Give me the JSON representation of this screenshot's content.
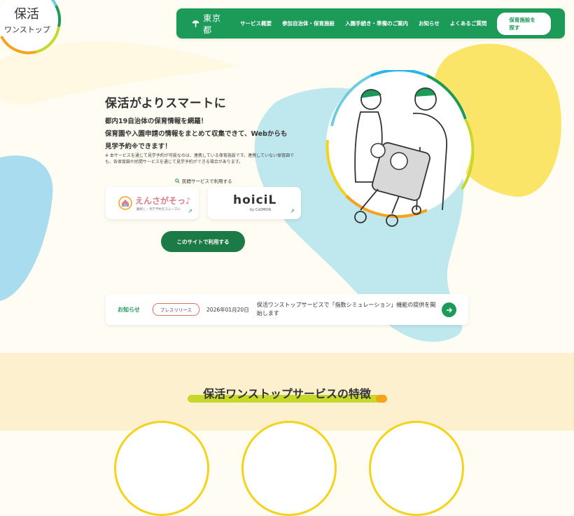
{
  "site": {
    "logo_text_line1": "保活",
    "logo_text_line2": "ワンストップ"
  },
  "header": {
    "org_name": "東京都",
    "nav": [
      "サービス概要",
      "参加自治体・保育施設",
      "入園手続き・準備のご案内",
      "お知らせ",
      "よくあるご質問"
    ],
    "search_button": "保育施設を探す"
  },
  "hero": {
    "title": "保活がよりスマートに",
    "lines": [
      "都内19自治体の保育情報を網羅！",
      "保育園や入園申請の情報をまとめて収集できて、Webからも",
      "見学予約※できます！"
    ],
    "note": "※ 本サービスを通じて見学予約が可能なのは、連携している保育施設です。連携していない保育園でも、各保育園や民間サービスを通じて見学予約ができる場合があります。",
    "private_services_label": "民間サービスで利用する",
    "cards": [
      {
        "name": "えんさがそっ♪",
        "sub": "園探し・見学予約をスムーズに"
      },
      {
        "name": "hoiciL",
        "sub": "by CoDMON"
      }
    ],
    "cta": "このサイトで利用する"
  },
  "news": {
    "label": "お知らせ",
    "tag": "プレスリリース",
    "date": "2026年01月20日",
    "title": "保活ワンストップサービスで「指数シミュレーション」機能の提供を開始します"
  },
  "features": {
    "title": "保活ワンストップサービスの特徴"
  },
  "colors": {
    "brand_green": "#1b9a58",
    "cta_green": "#1b7a45",
    "accent_yellow": "#f5d21b",
    "accent_orange": "#f6a21a",
    "light_blue": "#bfe8ee",
    "feature_bg": "#fdf0cf"
  },
  "icons": [
    "tokyo-emblem-icon",
    "search-icon",
    "external-arrow-icon",
    "arrow-right-icon"
  ]
}
